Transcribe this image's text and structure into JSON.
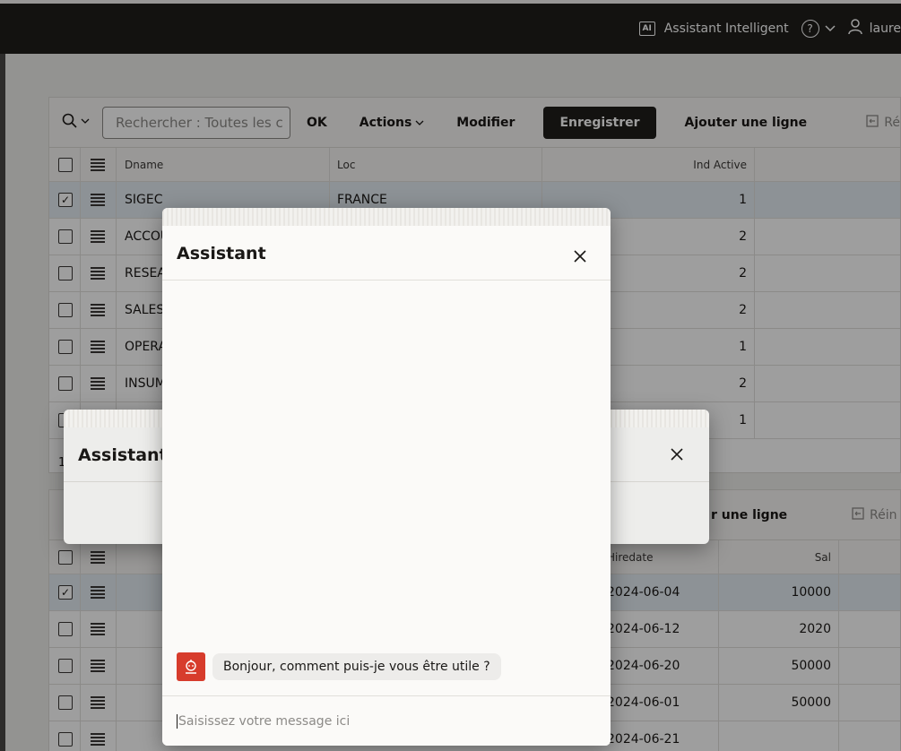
{
  "topbar": {
    "ai_badge": "AI",
    "ai_label": "Assistant Intelligent",
    "help_glyph": "?",
    "user_name": "laure"
  },
  "toolbar1": {
    "search_placeholder": "Rechercher : Toutes les c",
    "ok": "OK",
    "actions": "Actions",
    "modifier": "Modifier",
    "enregistrer": "Enregistrer",
    "ajouter": "Ajouter une ligne",
    "reset": "Ré"
  },
  "grid1": {
    "headers": {
      "dname": "Dname",
      "loc": "Loc",
      "ind_active": "Ind Active"
    },
    "rows": [
      {
        "dname": "SIGEC",
        "loc": "FRANCE",
        "ind": "1",
        "checked": true
      },
      {
        "dname": "ACCOU",
        "loc": "",
        "ind": "2",
        "checked": false
      },
      {
        "dname": "RESEA",
        "loc": "",
        "ind": "2",
        "checked": false
      },
      {
        "dname": "SALES",
        "loc": "",
        "ind": "2",
        "checked": false
      },
      {
        "dname": "OPERA",
        "loc": "",
        "ind": "1",
        "checked": false
      },
      {
        "dname": "INSUM",
        "loc": "",
        "ind": "2",
        "checked": false
      },
      {
        "dname": "",
        "loc": "",
        "ind": "1",
        "checked": false
      }
    ],
    "footer": "1"
  },
  "toolbar2": {
    "ajouter_partial": "r une ligne",
    "reset_partial": "Réin"
  },
  "grid2": {
    "headers": {
      "hiredate": "Hiredate",
      "sal": "Sal"
    },
    "rows": [
      {
        "hiredate": "2024-06-04",
        "sal": "10000",
        "checked": true
      },
      {
        "hiredate": "2024-06-12",
        "sal": "2020",
        "checked": false
      },
      {
        "hiredate": "2024-06-20",
        "sal": "50000",
        "checked": false
      },
      {
        "hiredate": "2024-06-01",
        "sal": "50000",
        "checked": false
      },
      {
        "hiredate": "2024-06-21",
        "sal": "",
        "checked": false
      }
    ]
  },
  "dialog_back": {
    "title": "Assistant"
  },
  "dialog_front": {
    "title": "Assistant",
    "greeting": "Bonjour, comment puis-je vous être utile ?",
    "input_placeholder": "Saisissez votre message ici"
  },
  "colors": {
    "primary": "#1f1d1b",
    "bot": "#d73c2c",
    "selected_row": "#e4ecf2"
  }
}
